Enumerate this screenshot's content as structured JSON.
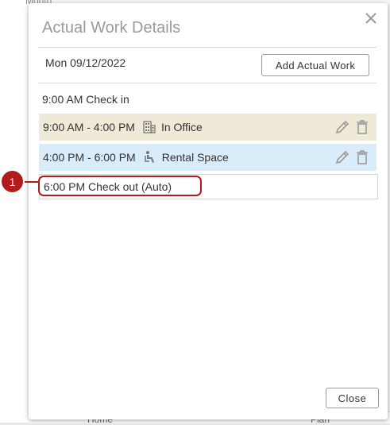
{
  "background": {
    "month_label": "Month",
    "bottom_home": "Home",
    "bottom_plan": "Plan"
  },
  "dialog": {
    "title": "Actual Work Details",
    "close_icon": "close-icon",
    "date": "Mon 09/12/2022",
    "add_button": "Add Actual Work",
    "check_in": "9:00 AM Check in",
    "entries": [
      {
        "time": "9:00 AM - 4:00 PM",
        "type_icon": "building-icon",
        "location": "In Office",
        "color": "#efe9d8"
      },
      {
        "time": "4:00 PM - 6:00 PM",
        "type_icon": "seated-person-icon",
        "location": "Rental Space",
        "color": "#d9ecf9"
      }
    ],
    "check_out": "6:00 PM Check out (Auto)",
    "close_button": "Close"
  },
  "annotation": {
    "badge": "1",
    "color": "#b11b1b"
  }
}
